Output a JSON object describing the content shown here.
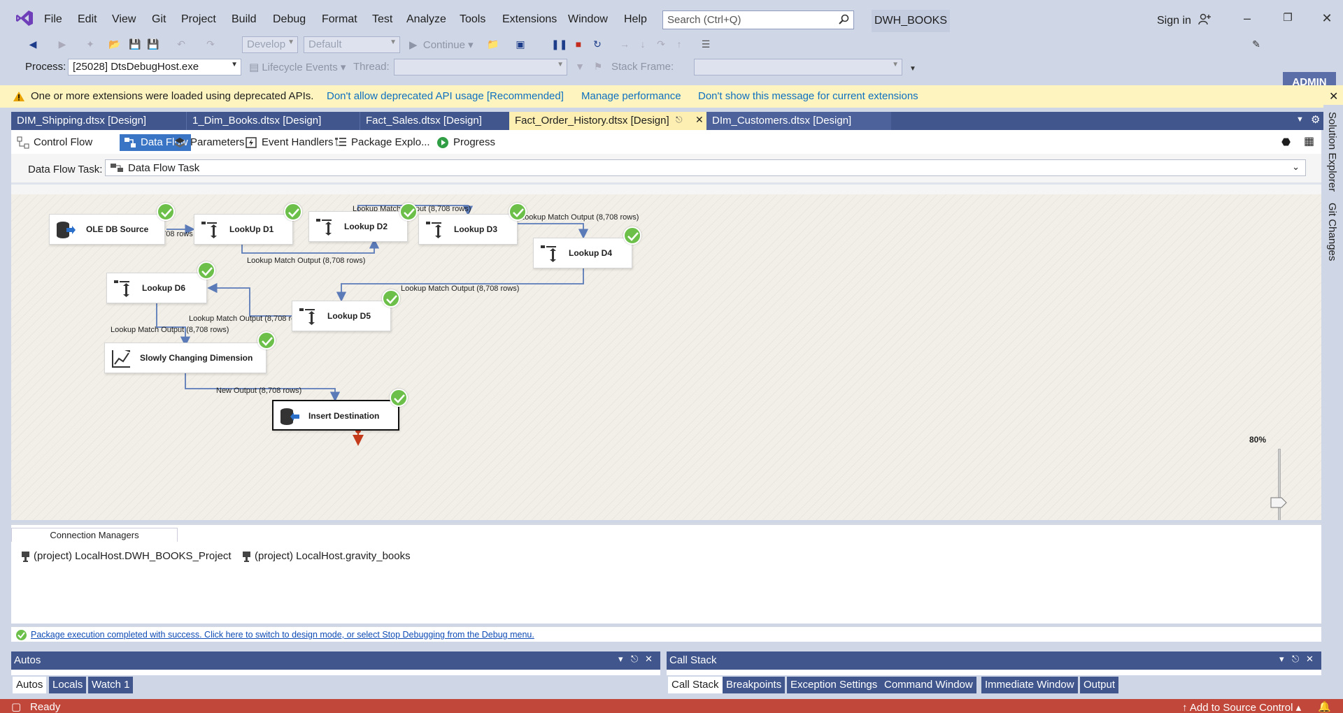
{
  "menu": {
    "items": [
      "File",
      "Edit",
      "View",
      "Git",
      "Project",
      "Build",
      "Debug",
      "Format",
      "Test",
      "Analyze",
      "Tools",
      "Extensions",
      "Window",
      "Help"
    ],
    "search_placeholder": "Search (Ctrl+Q)",
    "solution_name": "DWH_BOOKS",
    "sign_in": "Sign in",
    "admin_label": "ADMIN"
  },
  "toolbar": {
    "config_combo": "Develop",
    "platform_combo": "Default",
    "continue_label": "Continue",
    "process_label": "Process:",
    "process_value": "[25028] DtsDebugHost.exe",
    "lifecycle_label": "Lifecycle Events",
    "thread_label": "Thread:",
    "stack_frame_label": "Stack Frame:"
  },
  "infobar": {
    "message": "One or more extensions were loaded using deprecated APIs.",
    "links": [
      "Don't allow deprecated API usage [Recommended]",
      "Manage performance",
      "Don't show this message for current extensions"
    ]
  },
  "doc_tabs": [
    {
      "label": "DIM_Shipping.dtsx [Design]",
      "active": false
    },
    {
      "label": "1_Dim_Books.dtsx [Design]",
      "active": false
    },
    {
      "label": "Fact_Sales.dtsx [Design]",
      "active": false
    },
    {
      "label": "Fact_Order_History.dtsx [Design]",
      "active": true
    },
    {
      "label": "DIm_Customers.dtsx [Design]",
      "active": false
    }
  ],
  "side_tabs": [
    "Solution Explorer",
    "Git Changes"
  ],
  "designer_tabs": [
    {
      "label": "Control Flow",
      "icon": "control-flow-icon",
      "active": false
    },
    {
      "label": "Data Flow",
      "icon": "data-flow-icon",
      "active": true
    },
    {
      "label": "Parameters",
      "icon": "parameters-icon",
      "active": false
    },
    {
      "label": "Event Handlers",
      "icon": "event-handlers-icon",
      "active": false
    },
    {
      "label": "Package Explo...",
      "icon": "package-explorer-icon",
      "active": false
    },
    {
      "label": "Progress",
      "icon": "progress-icon",
      "active": false
    }
  ],
  "data_flow_task": {
    "label": "Data Flow Task:",
    "value": "Data Flow Task"
  },
  "flow": {
    "nodes": {
      "ole_db_source": "OLE DB Source",
      "lookup_d1": "LookUp D1",
      "lookup_d2": "Lookup D2",
      "lookup_d3": "Lookup D3",
      "lookup_d4": "Lookup D4",
      "lookup_d5": "Lookup D5",
      "lookup_d6": "Lookup D6",
      "scd": "Slowly Changing Dimension",
      "insert_destination": "Insert Destination"
    },
    "paths": {
      "src_rows": "8,708 rows",
      "lookup_match": "Lookup Match Output (8,708 rows)",
      "new_output": "New Output (8,708 rows)"
    },
    "zoom": "80%"
  },
  "connection_managers": {
    "tab_label": "Connection Managers",
    "items": [
      "(project) LocalHost.DWH_BOOKS_Project",
      "(project) LocalHost.gravity_books"
    ]
  },
  "status_message": "Package execution completed with success. Click here to switch to design mode, or select Stop Debugging from the Debug menu.",
  "autos_window": {
    "title": "Autos",
    "tabs": [
      "Autos",
      "Locals",
      "Watch 1"
    ]
  },
  "callstack_window": {
    "title": "Call Stack",
    "tabs": [
      "Call Stack",
      "Breakpoints",
      "Exception Settings",
      "Command Window",
      "Immediate Window",
      "Output"
    ]
  },
  "statusbar": {
    "ready": "Ready",
    "source_control": "Add to Source Control"
  },
  "colors": {
    "accent": "#40568d",
    "status_bar": "#c0473a",
    "success": "#6cc04a",
    "active_tab": "#fcefb1"
  }
}
